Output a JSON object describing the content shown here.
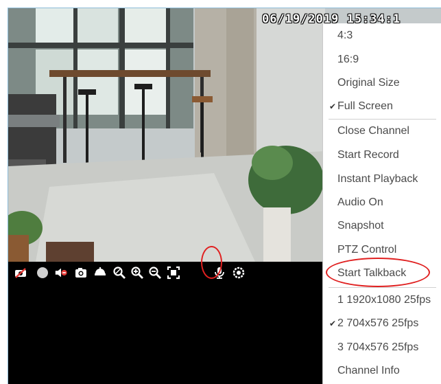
{
  "video": {
    "osd_timestamp": "06/19/2019 15:34:1"
  },
  "toolbar": {
    "icons": [
      "camera-off-icon",
      "record-icon",
      "mute-icon",
      "snapshot-icon",
      "ptz-icon",
      "zoom-area-icon",
      "zoom-in-icon",
      "zoom-out-icon",
      "fit-screen-icon",
      "microphone-icon",
      "settings-icon"
    ]
  },
  "context_menu": {
    "items": [
      {
        "label": "4:3"
      },
      {
        "label": "16:9"
      },
      {
        "label": "Original Size"
      },
      {
        "label": "Full Screen",
        "check": "✔"
      },
      {
        "label": "Close Channel"
      },
      {
        "label": "Start Record"
      },
      {
        "label": "Instant Playback"
      },
      {
        "label": "Audio On"
      },
      {
        "label": "Snapshot"
      },
      {
        "label": "PTZ Control"
      },
      {
        "label": "Start Talkback"
      },
      {
        "label": "1 1920x1080 25fps"
      },
      {
        "label": "2 704x576 25fps",
        "check": "✔"
      },
      {
        "label": "3 704x576 25fps"
      },
      {
        "label": "Channel Info"
      }
    ]
  },
  "colors": {
    "highlight_ring": "#e02020",
    "menu_text": "#4a4a4a",
    "frame_border": "#8bbbd8"
  }
}
